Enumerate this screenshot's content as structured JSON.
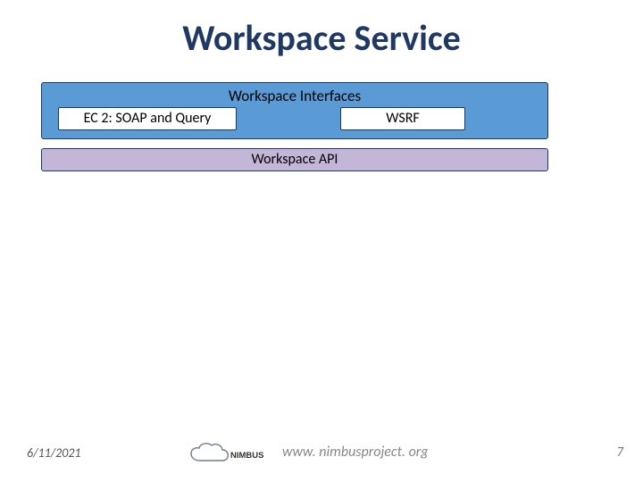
{
  "title": "Workspace Service",
  "interfaces": {
    "label": "Workspace Interfaces",
    "ec2": "EC 2: SOAP and Query",
    "wsrf": "WSRF"
  },
  "api": "Workspace API",
  "footer": {
    "date": "6/11/2021",
    "url": "www. nimbusproject. org",
    "page": "7"
  },
  "logo": {
    "brand": "NIMBUS"
  }
}
